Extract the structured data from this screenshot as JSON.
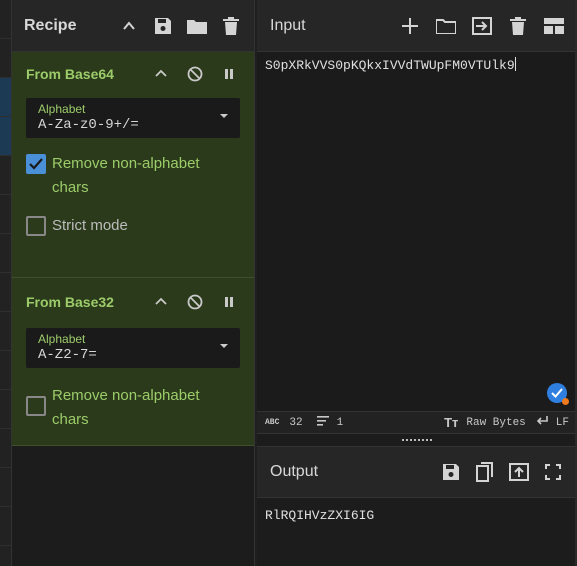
{
  "recipe": {
    "title": "Recipe",
    "operations": [
      {
        "title": "From Base64",
        "alphabet_label": "Alphabet",
        "alphabet_value": "A-Za-z0-9+/=",
        "options": [
          {
            "label": "Remove non-alphabet chars",
            "checked": true
          },
          {
            "label": "Strict mode",
            "checked": false
          }
        ]
      },
      {
        "title": "From Base32",
        "alphabet_label": "Alphabet",
        "alphabet_value": "A-Z2-7=",
        "options": [
          {
            "label": "Remove non-alphabet chars",
            "checked": false
          }
        ]
      }
    ]
  },
  "input": {
    "title": "Input",
    "text": "S0pXRkVVS0pKQkxIVVdTWUpFM0VTUlk9"
  },
  "status": {
    "abc_label": "ABC",
    "length": "32",
    "lines": "1",
    "format": "Raw Bytes",
    "eol": "LF"
  },
  "output": {
    "title": "Output",
    "text": "RlRQIHVzZXI6IG"
  },
  "colors": {
    "op_bg": "#2b3a1b",
    "accent_green": "#9ccc6a",
    "check_blue": "#4a90d9"
  }
}
